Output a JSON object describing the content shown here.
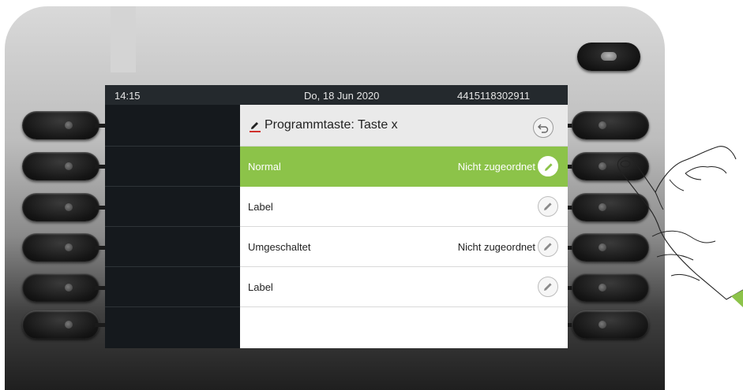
{
  "status_bar": {
    "time": "14:15",
    "date": "Do, 18 Jun 2020",
    "number": "4415118302911"
  },
  "panel": {
    "title": "Programmtaste: Taste x",
    "title_icon": "pencil-icon",
    "back_icon": "back-arrow-icon"
  },
  "rows": [
    {
      "label": "Normal",
      "value": "Nicht zugeordnet",
      "selected": true,
      "icon": "pencil-icon"
    },
    {
      "label": "Label",
      "value": "",
      "selected": false,
      "icon": "pencil-icon"
    },
    {
      "label": "Umgeschaltet",
      "value": "Nicht zugeordnet",
      "selected": false,
      "icon": "pencil-icon"
    },
    {
      "label": "Label",
      "value": "",
      "selected": false,
      "icon": "pencil-icon"
    }
  ],
  "colors": {
    "selected_row": "#8cc349",
    "status_bar": "#24292d",
    "screen_background": "#15191d"
  }
}
